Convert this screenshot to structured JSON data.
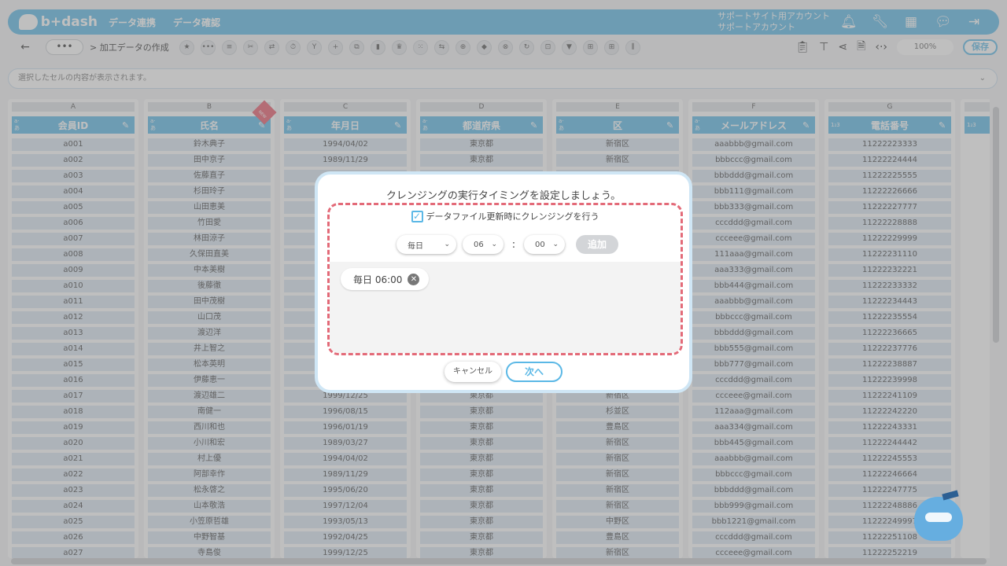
{
  "header": {
    "logo_text": "b+dash",
    "nav": [
      "データ連携",
      "データ確認"
    ],
    "account_line1": "サポートサイト用アカウント",
    "account_line2": "サポートアカウント",
    "icons": [
      "bell-icon",
      "wrench-icon",
      "grid-icon",
      "chat-icon",
      "logout-icon"
    ]
  },
  "toolbar": {
    "back": "←",
    "more": "•••",
    "breadcrumb": "> 加工データの作成",
    "tool_glyphs": [
      "★",
      "•••",
      "≡",
      "✂",
      "⇄",
      "⏱",
      "Y",
      "+",
      "⧉",
      "▮",
      "♛",
      "⁙",
      "⇆",
      "⊕",
      "◆",
      "⊗",
      "↻",
      "⊡",
      "▼",
      "⊞",
      "⊞",
      "⫼"
    ],
    "right_icons": [
      "clipboard-icon",
      "hierarchy-icon",
      "share-icon",
      "file-icon",
      "code-icon"
    ],
    "zoom": "100%",
    "save_label": "保存"
  },
  "cell_bar": {
    "placeholder": "選択したセルの内容が表示されます。"
  },
  "grid": {
    "columns": [
      {
        "letter": "A",
        "title": "会員ID",
        "type": "text",
        "new": false,
        "cells": [
          "a001",
          "a002",
          "a003",
          "a004",
          "a005",
          "a006",
          "a007",
          "a008",
          "a009",
          "a010",
          "a011",
          "a012",
          "a013",
          "a014",
          "a015",
          "a016",
          "a017",
          "a018",
          "a019",
          "a020",
          "a021",
          "a022",
          "a023",
          "a024",
          "a025",
          "a026",
          "a027"
        ]
      },
      {
        "letter": "B",
        "title": "氏名",
        "type": "text",
        "new": true,
        "cells": [
          "鈴木典子",
          "田中京子",
          "佐藤直子",
          "杉田玲子",
          "山田恵美",
          "竹田愛",
          "林田涼子",
          "久保田直美",
          "中本美樹",
          "後藤徹",
          "田中茂樹",
          "山口茂",
          "渡辺洋",
          "井上智之",
          "松本英明",
          "伊藤恵一",
          "渡辺雄二",
          "南健一",
          "西川和也",
          "小川和宏",
          "村上優",
          "阿部幸作",
          "松永啓之",
          "山本敬浩",
          "小笠原哲雄",
          "中野智基",
          "寺島俊"
        ]
      },
      {
        "letter": "C",
        "title": "年月日",
        "type": "text",
        "new": false,
        "cells": [
          "1994/04/02",
          "1989/11/29",
          "",
          "",
          "",
          "",
          "",
          "",
          "",
          "",
          "",
          "",
          "",
          "",
          "",
          "",
          "1999/12/25",
          "1996/08/15",
          "1996/01/19",
          "1989/03/27",
          "1994/04/02",
          "1989/11/29",
          "1995/06/20",
          "1997/12/04",
          "1993/05/13",
          "1992/04/25",
          "1999/12/25"
        ]
      },
      {
        "letter": "D",
        "title": "都道府県",
        "type": "text",
        "new": false,
        "cells": [
          "東京都",
          "東京都",
          "",
          "",
          "",
          "",
          "",
          "",
          "",
          "",
          "",
          "",
          "",
          "",
          "",
          "",
          "東京都",
          "東京都",
          "東京都",
          "東京都",
          "東京都",
          "東京都",
          "東京都",
          "東京都",
          "東京都",
          "東京都",
          "東京都"
        ]
      },
      {
        "letter": "E",
        "title": "区",
        "type": "text",
        "new": false,
        "cells": [
          "新宿区",
          "新宿区",
          "",
          "",
          "",
          "",
          "",
          "",
          "",
          "",
          "",
          "",
          "",
          "",
          "",
          "",
          "新宿区",
          "杉並区",
          "豊島区",
          "新宿区",
          "新宿区",
          "新宿区",
          "新宿区",
          "新宿区",
          "中野区",
          "豊島区",
          "新宿区"
        ]
      },
      {
        "letter": "F",
        "title": "メールアドレス",
        "type": "text",
        "new": false,
        "cells": [
          "aaabbb@gmail.com",
          "bbbccc@gmail.com",
          "bbbddd@gmail.com",
          "bbb111@gmail.com",
          "bbb333@gmail.com",
          "cccddd@gmail.com",
          "cccеee@gmail.com",
          "111aaa@gmail.com",
          "aaa333@gmail.com",
          "bbb444@gmail.com",
          "aaabbb@gmail.com",
          "bbbccc@gmail.com",
          "bbbddd@gmail.com",
          "bbb555@gmail.com",
          "bbb777@gmail.com",
          "cccddd@gmail.com",
          "ccceee@gmail.com",
          "112aaa@gmail.com",
          "aaa334@gmail.com",
          "bbb445@gmail.com",
          "aaabbb@gmail.com",
          "bbbccc@gmail.com",
          "bbbddd@gmail.com",
          "bbb999@gmail.com",
          "bbb1221@gmail.com",
          "cccddd@gmail.com",
          "ccceee@gmail.com"
        ]
      },
      {
        "letter": "G",
        "title": "電話番号",
        "type": "number",
        "new": false,
        "cells": [
          "11222223333",
          "11222224444",
          "11222225555",
          "11222226666",
          "11222227777",
          "11222228888",
          "11222229999",
          "11222231110",
          "11222232221",
          "11222233332",
          "11222234443",
          "11222235554",
          "11222236665",
          "11222237776",
          "11222238887",
          "11222239998",
          "11222241109",
          "11222242220",
          "11222243331",
          "11222244442",
          "11222245553",
          "11222246664",
          "11222247775",
          "11222248886",
          "11222249997",
          "11222251108",
          "11222252219"
        ]
      }
    ],
    "partial_type": "1₂3"
  },
  "modal": {
    "title": "クレンジングの実行タイミングを設定しましょう。",
    "checkbox_label": "データファイル更新時にクレンジングを行う",
    "checkbox_checked": true,
    "frequency": "毎日",
    "hour": "06",
    "colon": ":",
    "minute": "00",
    "add_label": "追加",
    "schedules": [
      "毎日 06:00"
    ],
    "cancel_label": "キャンセル",
    "next_label": "次へ"
  },
  "colors": {
    "accent": "#5bb8e6",
    "highlight_dash": "#e36a78"
  }
}
